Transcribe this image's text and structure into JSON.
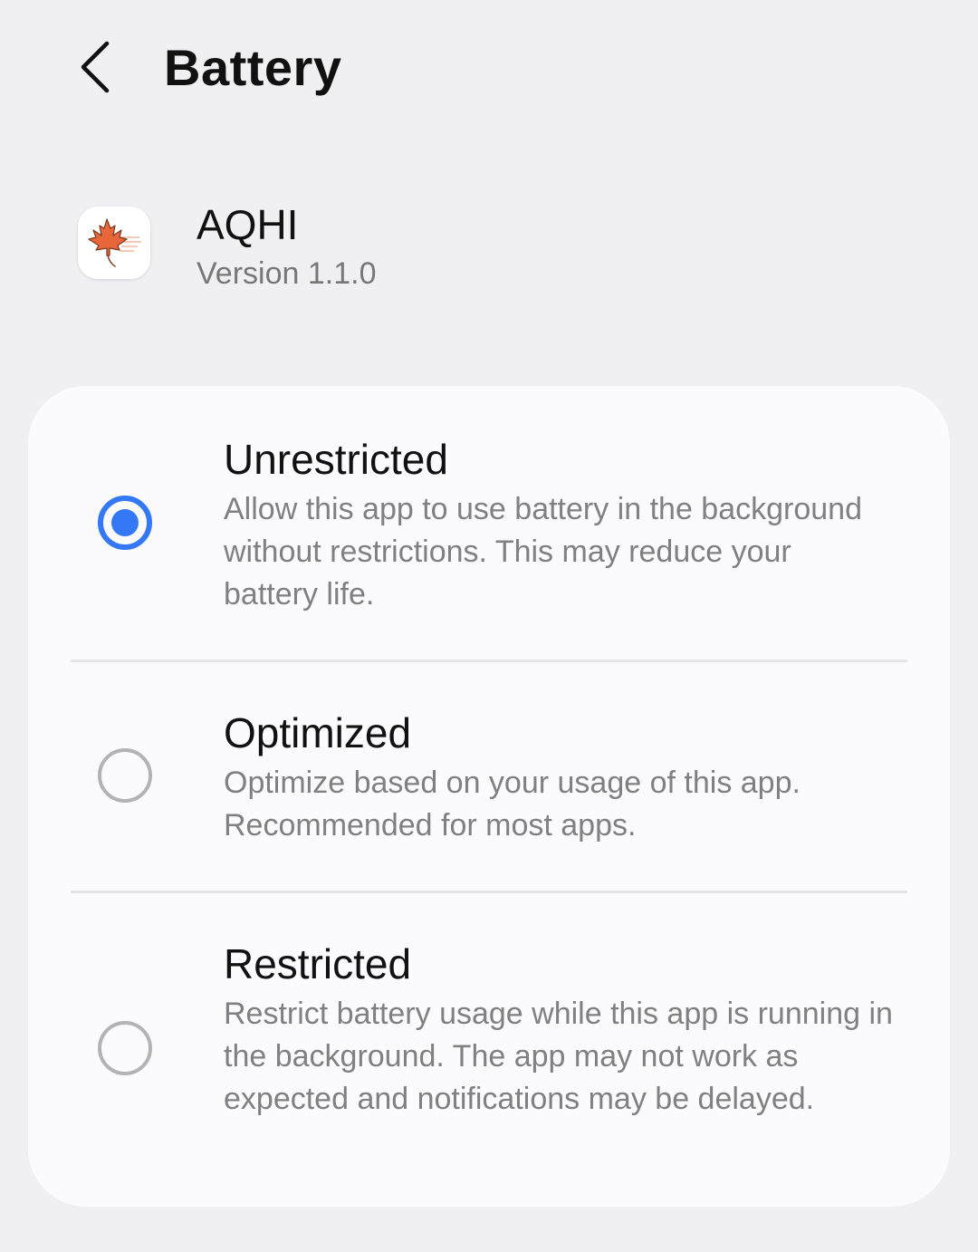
{
  "header": {
    "back_icon": "chevron-left-icon",
    "title": "Battery"
  },
  "app": {
    "icon": "maple-leaf-icon",
    "name": "AQHI",
    "version": "Version 1.1.0"
  },
  "options": [
    {
      "title": "Unrestricted",
      "description": "Allow this app to use battery in the background without restrictions. This may reduce your battery life.",
      "selected": true
    },
    {
      "title": "Optimized",
      "description": "Optimize based on your usage of this app. Recommended for most apps.",
      "selected": false
    },
    {
      "title": "Restricted",
      "description": "Restrict battery usage while this app is running in the background. The app may not work as expected and notifications may be delayed.",
      "selected": false
    }
  ],
  "colors": {
    "accent": "#3478f6",
    "background": "#f0f0f2",
    "card": "#fbfbfd",
    "secondary_text": "#808080",
    "leaf": "#e8663a"
  }
}
